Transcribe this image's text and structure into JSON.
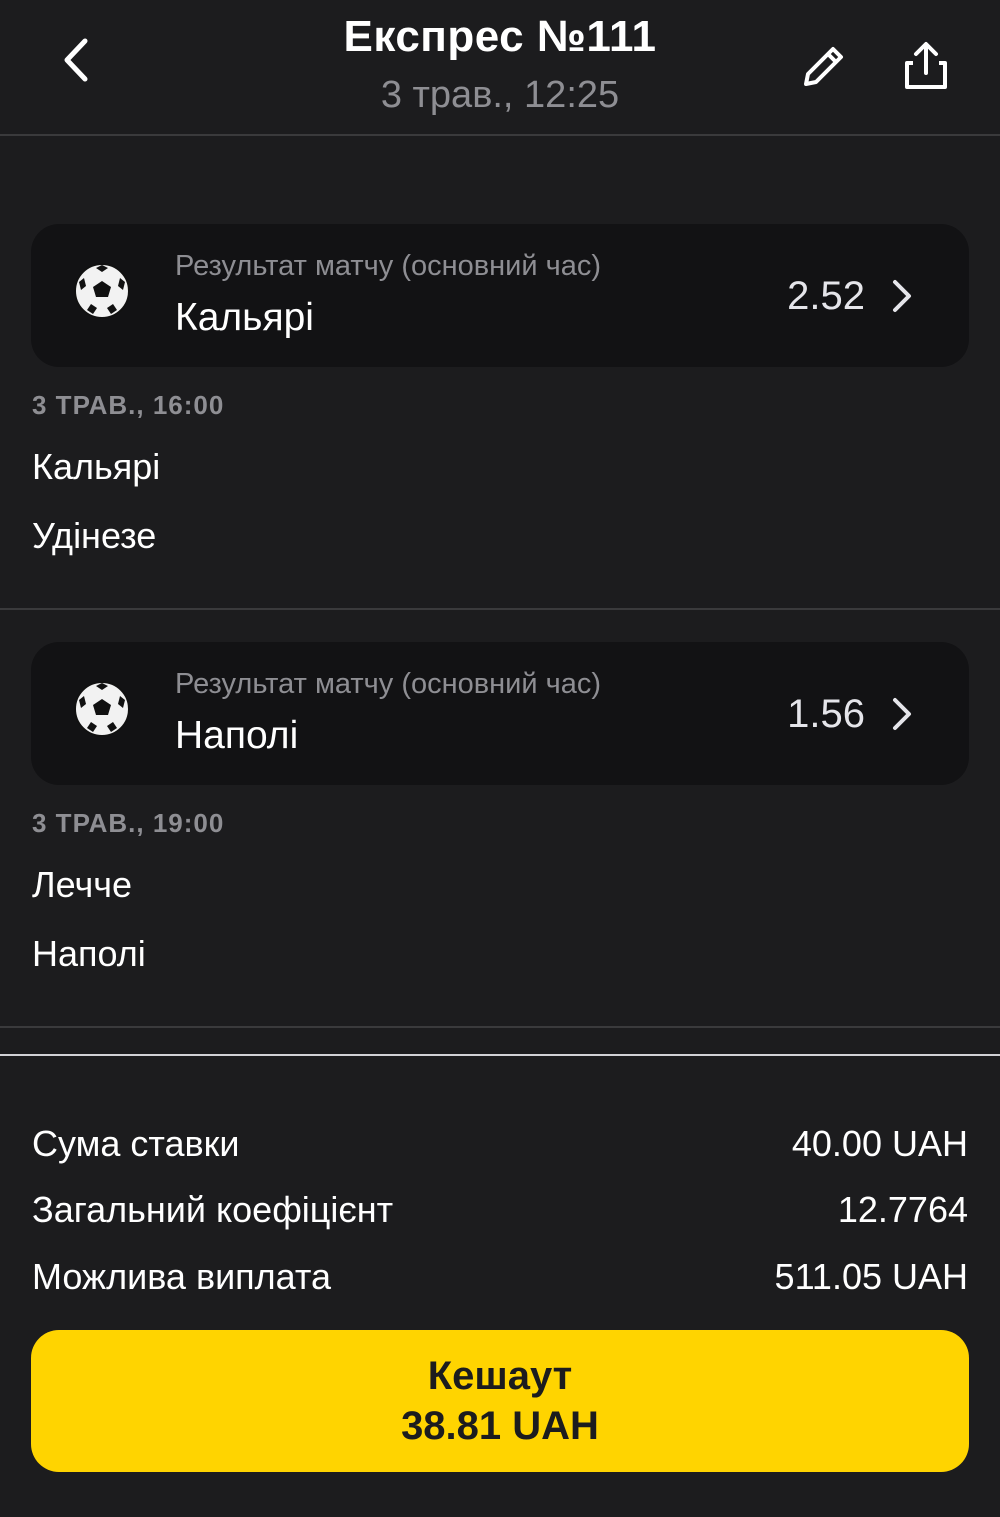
{
  "header": {
    "title": "Експрес №111",
    "subtitle": "3 трав., 12:25",
    "back_icon": "chevron-left-icon",
    "edit_icon": "pencil-icon",
    "share_icon": "share-icon"
  },
  "bets": [
    {
      "icon": "soccer-ball-icon",
      "market": "Результат матчу (основний час)",
      "selection": "Кальярі",
      "odds": "2.52",
      "time": "3 ТРАВ., 16:00",
      "team_home": "Кальярі",
      "team_away": "Удінезе"
    },
    {
      "icon": "soccer-ball-icon",
      "market": "Результат матчу (основний час)",
      "selection": "Наполі",
      "odds": "1.56",
      "time": "3 ТРАВ., 19:00",
      "team_home": "Лечче",
      "team_away": "Наполі"
    }
  ],
  "summary": {
    "stake_label": "Сума ставки",
    "stake_value": "40.00 UAH",
    "total_odds_label": "Загальний коефіцієнт",
    "total_odds_value": "12.7764",
    "payout_label": "Можлива виплата",
    "payout_value": "511.05 UAH"
  },
  "cashout": {
    "label": "Кешаут",
    "amount": "38.81 UAH"
  },
  "colors": {
    "background": "#1c1c1e",
    "card": "#121214",
    "accent": "#ffd400",
    "muted_text": "#8e8e93"
  }
}
